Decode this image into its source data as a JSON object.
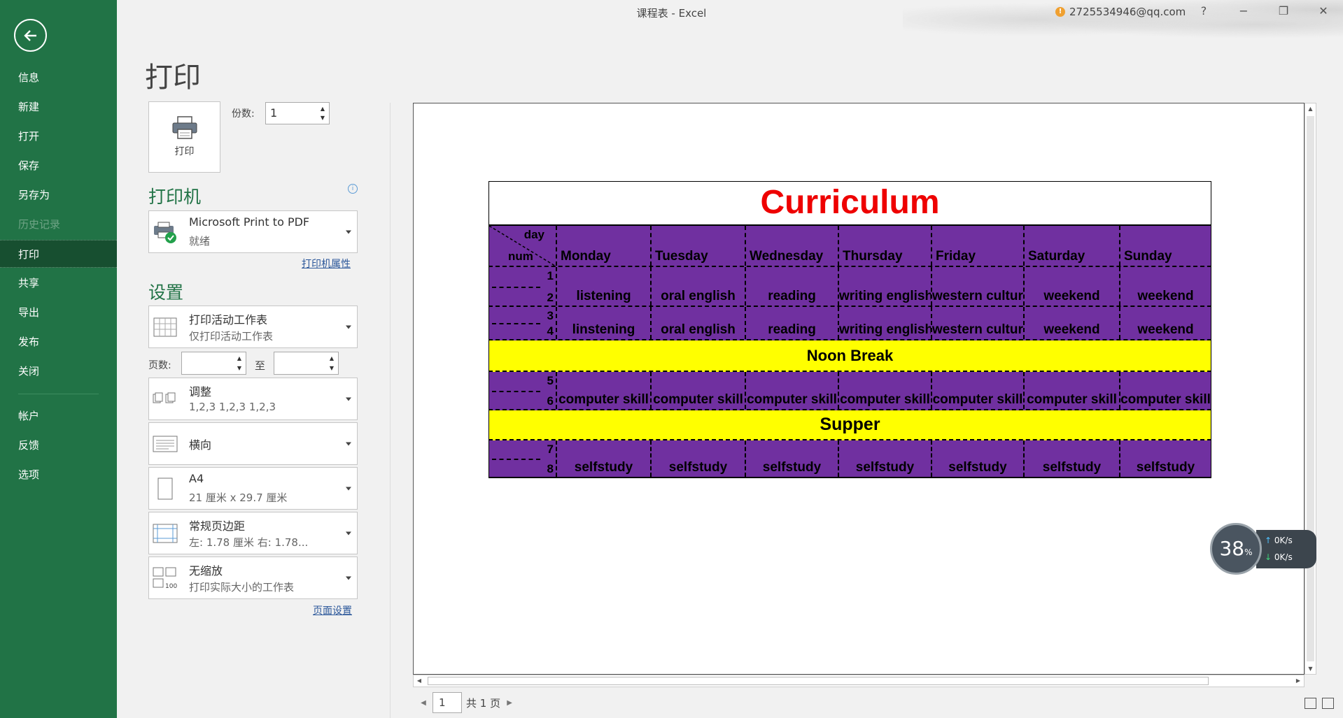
{
  "window": {
    "title": "课程表 - Excel",
    "account": "2725534946@qq.com",
    "help": "?",
    "minimize": "−",
    "restore": "❐",
    "close": "✕"
  },
  "nav": {
    "back": "←",
    "items": [
      "信息",
      "新建",
      "打开",
      "保存",
      "另存为",
      "历史记录",
      "打印",
      "共享",
      "导出",
      "发布",
      "关闭",
      "帐户",
      "反馈",
      "选项"
    ]
  },
  "print": {
    "page_title": "打印",
    "button_label": "打印",
    "copies_label": "份数:",
    "copies_value": "1"
  },
  "printer": {
    "heading": "打印机",
    "name": "Microsoft Print to PDF",
    "status": "就绪",
    "properties_link": "打印机属性"
  },
  "settings": {
    "heading": "设置",
    "scope_title": "打印活动工作表",
    "scope_sub": "仅打印活动工作表",
    "pages_label": "页数:",
    "to_label": "至",
    "collate_title": "调整",
    "collate_sub": "1,2,3    1,2,3    1,2,3",
    "orientation": "横向",
    "paper_title": "A4",
    "paper_sub": "21 厘米 x 29.7 厘米",
    "margins_title": "常规页边距",
    "margins_sub": "左:  1.78 厘米     右:  1.78...",
    "scaling_title": "无缩放",
    "scaling_sub": "打印实际大小的工作表",
    "page_setup_link": "页面设置"
  },
  "preview": {
    "page_number": "1",
    "page_total": "共 1 页",
    "sheet": {
      "title": "Curriculum",
      "corner_day": "day",
      "corner_num": "num",
      "days": [
        "Monday",
        "Tuesday",
        "Wednesday",
        "Thursday",
        "Friday",
        "Saturday",
        "Sunday"
      ],
      "rows": [
        {
          "n1": "1",
          "n2": "2",
          "cells": [
            "listening",
            "oral english",
            "reading",
            "writing english",
            "western culture",
            "weekend",
            "weekend"
          ]
        },
        {
          "n1": "3",
          "n2": "4",
          "cells": [
            "linstening",
            "oral english",
            "reading",
            "writing english",
            "western culture",
            "weekend",
            "weekend"
          ]
        },
        {
          "band": "Noon Break"
        },
        {
          "n1": "5",
          "n2": "6",
          "cells": [
            "computer skill",
            "computer skill",
            "computer skill",
            "computer skill",
            "computer skill",
            "computer skill",
            "computer skill"
          ]
        },
        {
          "band": "Supper"
        },
        {
          "n1": "7",
          "n2": "8",
          "cells": [
            "selfstudy",
            "selfstudy",
            "selfstudy",
            "selfstudy",
            "selfstudy",
            "selfstudy",
            "selfstudy"
          ]
        }
      ]
    }
  },
  "net_widget": {
    "percent": "38",
    "percent_sign": "%",
    "up": "0K/s",
    "down": "0K/s"
  },
  "colors": {
    "nav_green": "#217346",
    "sheet_purple": "#7030a0",
    "sheet_yellow": "#ffff00",
    "title_red": "#ee0000"
  }
}
